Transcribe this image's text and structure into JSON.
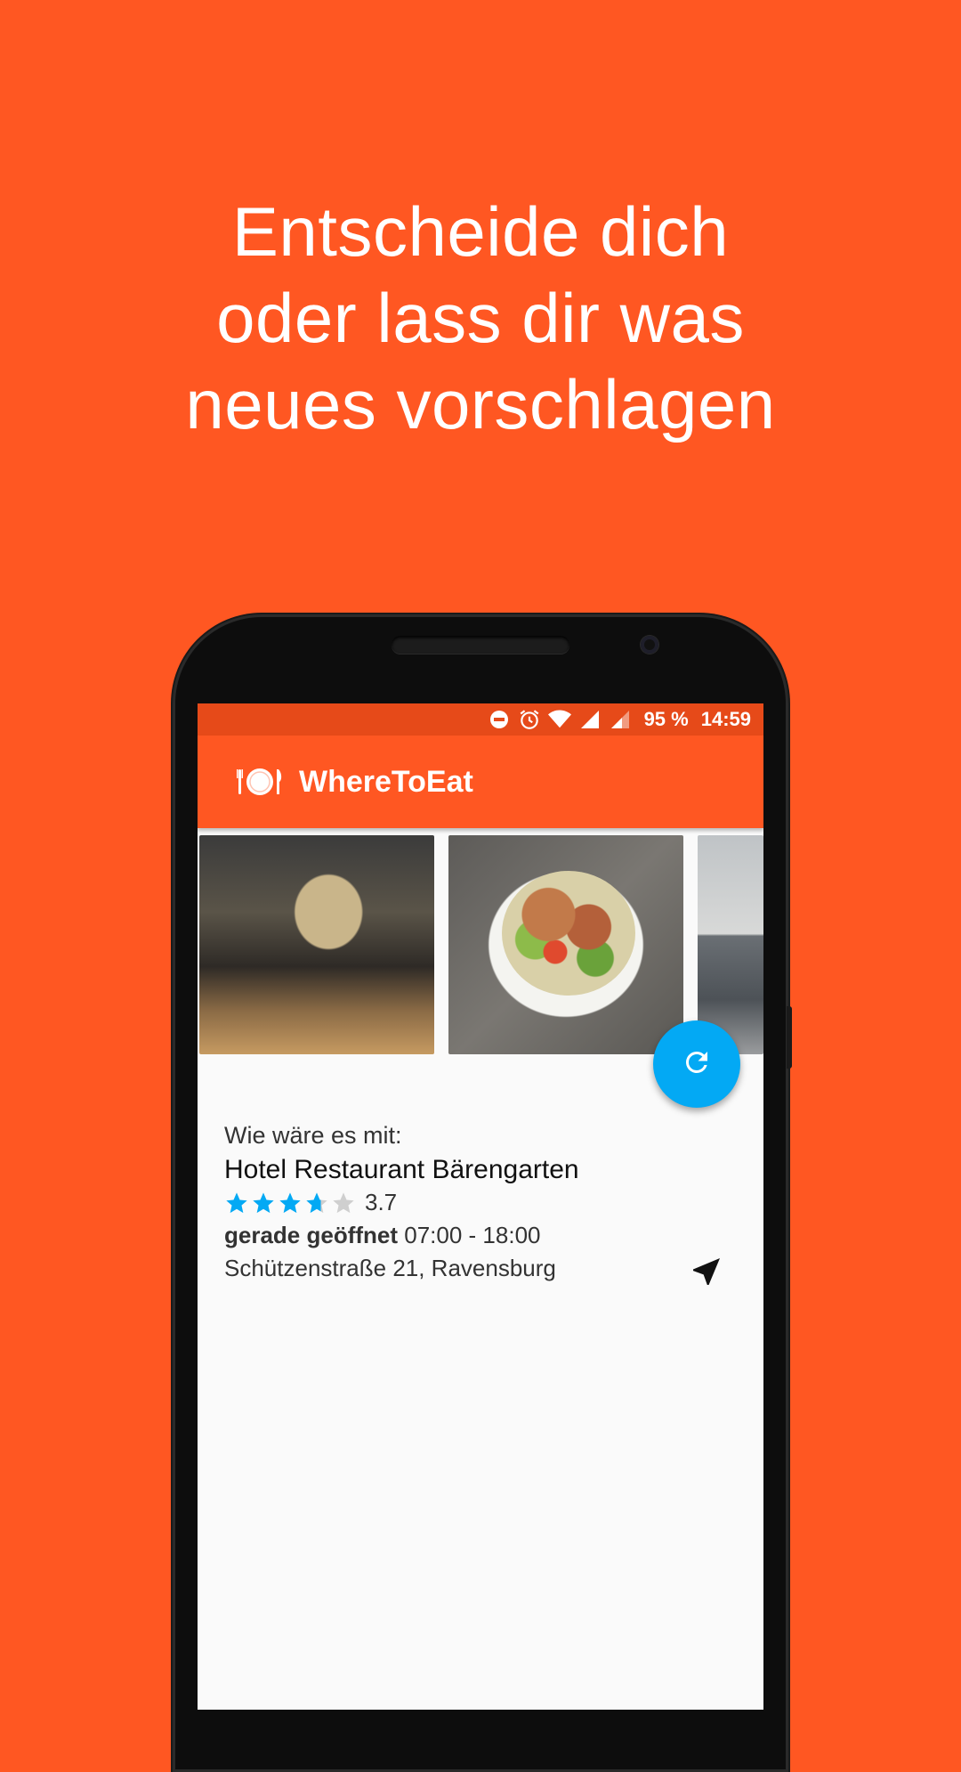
{
  "headline": {
    "line1": "Entscheide dich",
    "line2": "oder lass dir was",
    "line3": "neues vorschlagen"
  },
  "statusbar": {
    "battery": "95 %",
    "time": "14:59",
    "icons": [
      "do-not-disturb-icon",
      "alarm-icon",
      "wifi-icon",
      "signal-icon",
      "signal-icon"
    ]
  },
  "appbar": {
    "title": "WhereToEat",
    "logo": "plate-cutlery-icon"
  },
  "suggestion": {
    "prompt": "Wie wäre es mit:",
    "name": "Hotel Restaurant Bärengarten",
    "rating": 3.7,
    "rating_label": "3.7",
    "stars_max": 5,
    "open_label": "gerade geöffnet",
    "hours": "07:00 - 18:00",
    "address": "Schützenstraße 21, Ravensburg"
  },
  "colors": {
    "background": "#FF5722",
    "statusbar": "#E64A19",
    "fab": "#03A9F4",
    "star": "#03A9F4"
  },
  "icons": {
    "fab": "refresh-icon",
    "navigate": "navigation-arrow-icon"
  }
}
